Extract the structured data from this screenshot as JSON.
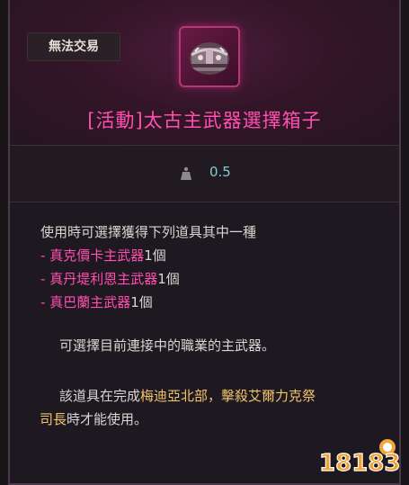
{
  "tooltip": {
    "trade_badge": "無法交易",
    "item_icon": "treasure-chest-icon",
    "title": "[活動]太古主武器選擇箱子",
    "weight_icon": "weight-icon",
    "weight_value": "0.5",
    "description": {
      "intro": "使用時可選擇獲得下列道具其中一種",
      "items": [
        {
          "prefix": "- ",
          "name": "真克價卡主武器",
          "qty": "1個"
        },
        {
          "prefix": "- ",
          "name": "真丹堤利恩主武器",
          "qty": "1個"
        },
        {
          "prefix": "- ",
          "name": "真巴蘭主武器",
          "qty": "1個"
        }
      ],
      "note1": "可選擇目前連接中的職業的主武器。",
      "note2_a": "該道具在完成",
      "note2_quest": "梅迪亞北部，擊殺艾爾力克祭",
      "note2_b": "司長",
      "note2_c": "時才能使用。"
    }
  },
  "watermark": {
    "logo_text": "18183",
    "icon": "18183-logo"
  },
  "colors": {
    "title_pink": "#ff4fb0",
    "weight_teal": "#7fcfcf",
    "quest_gold": "#f2c46b"
  }
}
